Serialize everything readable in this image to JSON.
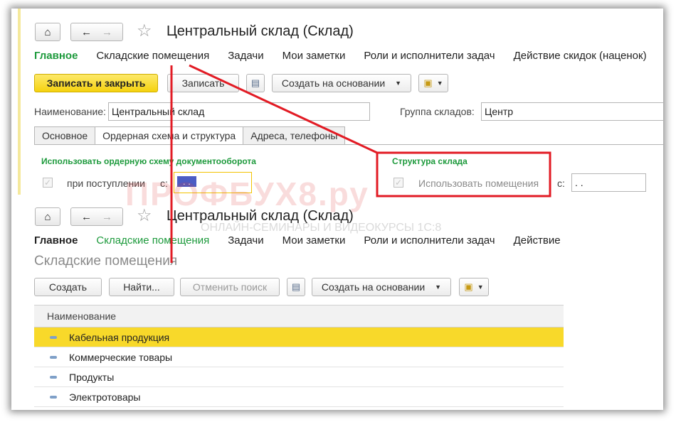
{
  "top": {
    "title": "Центральный склад (Склад)",
    "nav": [
      "Главное",
      "Складские помещения",
      "Задачи",
      "Мои заметки",
      "Роли и исполнители задач",
      "Действие скидок (наценок)"
    ],
    "toolbar": {
      "save_close": "Записать и закрыть",
      "save": "Записать",
      "create_based": "Создать на основании"
    },
    "name_label": "Наименование:",
    "name_value": "Центральный склад",
    "group_label": "Группа складов:",
    "group_value": "Центр",
    "tabs": [
      "Основное",
      "Ордерная схема и структура",
      "Адреса, телефоны"
    ],
    "order_section": "Использовать ордерную схему документооборота",
    "on_receipt": "при поступлении",
    "from_label": "с:",
    "date_value": ". .",
    "structure_section": "Структура склада",
    "use_rooms": "Использовать помещения",
    "from_label2": "с:",
    "date_value2": ". ."
  },
  "bottom": {
    "title": "Центральный склад (Склад)",
    "nav": [
      "Главное",
      "Складские помещения",
      "Задачи",
      "Мои заметки",
      "Роли и исполнители задач",
      "Действие"
    ],
    "page_title": "Складские помещения",
    "toolbar": {
      "create": "Создать",
      "find": "Найти...",
      "cancel_search": "Отменить поиск",
      "create_based": "Создать на основании"
    },
    "column_header": "Наименование",
    "rows": [
      "Кабельная продукция",
      "Коммерческие товары",
      "Продукты",
      "Электротовары"
    ]
  },
  "watermark": "ПРОФБУХ8.ру",
  "watermark_sub": "ОНЛАЙН-СЕМИНАРЫ И ВИДЕОКУРСЫ 1С:8",
  "colors": {
    "accent_green": "#1d9a3c",
    "highlight_yellow": "#f8d92a",
    "annotation_red": "#e21b24"
  }
}
